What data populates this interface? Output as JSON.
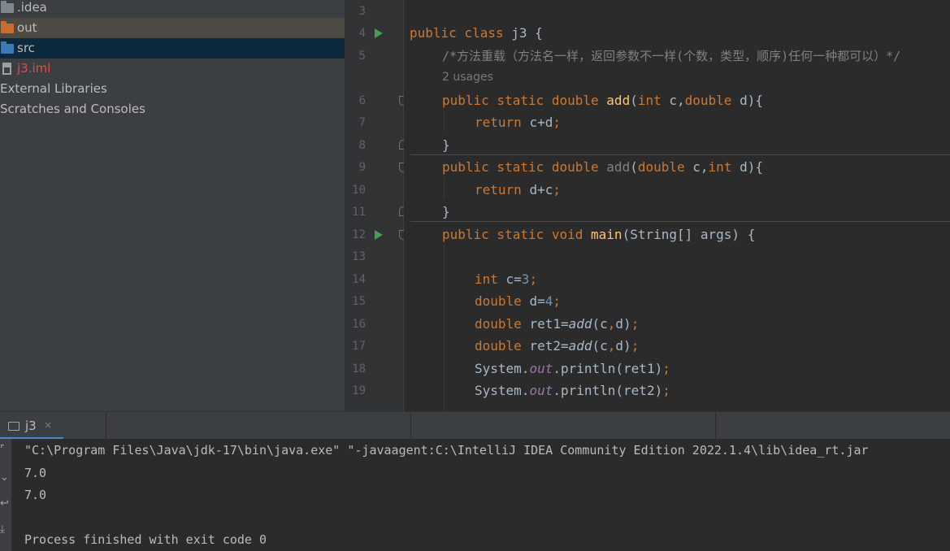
{
  "project_tree": {
    "items": [
      {
        "label": ".idea",
        "icon": "folder-icon"
      },
      {
        "label": "out",
        "icon": "folder-icon"
      },
      {
        "label": "src",
        "icon": "folder-icon"
      },
      {
        "label": "j3.iml",
        "icon": "module-file-icon"
      },
      {
        "label": "External Libraries"
      },
      {
        "label": "Scratches and Consoles"
      }
    ]
  },
  "editor": {
    "line_numbers": [
      "3",
      "4",
      "5",
      "6",
      "7",
      "8",
      "9",
      "10",
      "11",
      "12",
      "13",
      "14",
      "15",
      "16",
      "17",
      "18",
      "19"
    ],
    "usages_hint": "2 usages",
    "code": {
      "l4": [
        "public class ",
        "j3 {"
      ],
      "l5": "/*方法重载（方法名一样，返回参数不一样(个数，类型，顺序)任何一种都可以）*/",
      "l6": [
        "public static double ",
        "add",
        "(",
        "int ",
        "c,",
        "double ",
        "d){"
      ],
      "l7": [
        "return ",
        "c+d",
        ";"
      ],
      "l8": "}",
      "l9": [
        "public static double ",
        "add",
        "(",
        "double ",
        "c,",
        "int ",
        "d){"
      ],
      "l10": [
        "return ",
        "d+c",
        ";"
      ],
      "l11": "}",
      "l12": [
        "public static void ",
        "main",
        "(String[] args) {"
      ],
      "l14": [
        "int ",
        "c=",
        "3",
        ";"
      ],
      "l15": [
        "double ",
        "d=",
        "4",
        ";"
      ],
      "l16": [
        "double ",
        "ret1=",
        "add",
        "(c",
        ",",
        "d)",
        ";"
      ],
      "l17": [
        "double ",
        "ret2=",
        "add",
        "(c",
        ",",
        "d)",
        ";"
      ],
      "l18": [
        "System.",
        "out",
        ".println(ret1)",
        ";"
      ],
      "l19": [
        "System.",
        "out",
        ".println(ret2)",
        ";"
      ]
    }
  },
  "run_panel": {
    "tab_label": "j3",
    "tab_close": "×",
    "output": [
      "\"C:\\Program Files\\Java\\jdk-17\\bin\\java.exe\" \"-javaagent:C:\\IntelliJ IDEA Community Edition 2022.1.4\\lib\\idea_rt.jar",
      "7.0",
      "7.0",
      "",
      "Process finished with exit code 0"
    ]
  },
  "colors": {
    "keyword": "#cc7832",
    "method": "#ffc66d",
    "number": "#6897bb",
    "static_field": "#9876aa",
    "comment": "#808080",
    "run_icon": "#499c54",
    "selected_row": "#0d293e",
    "out_folder": "#c96d2c",
    "src_folder": "#3a7ab5"
  }
}
